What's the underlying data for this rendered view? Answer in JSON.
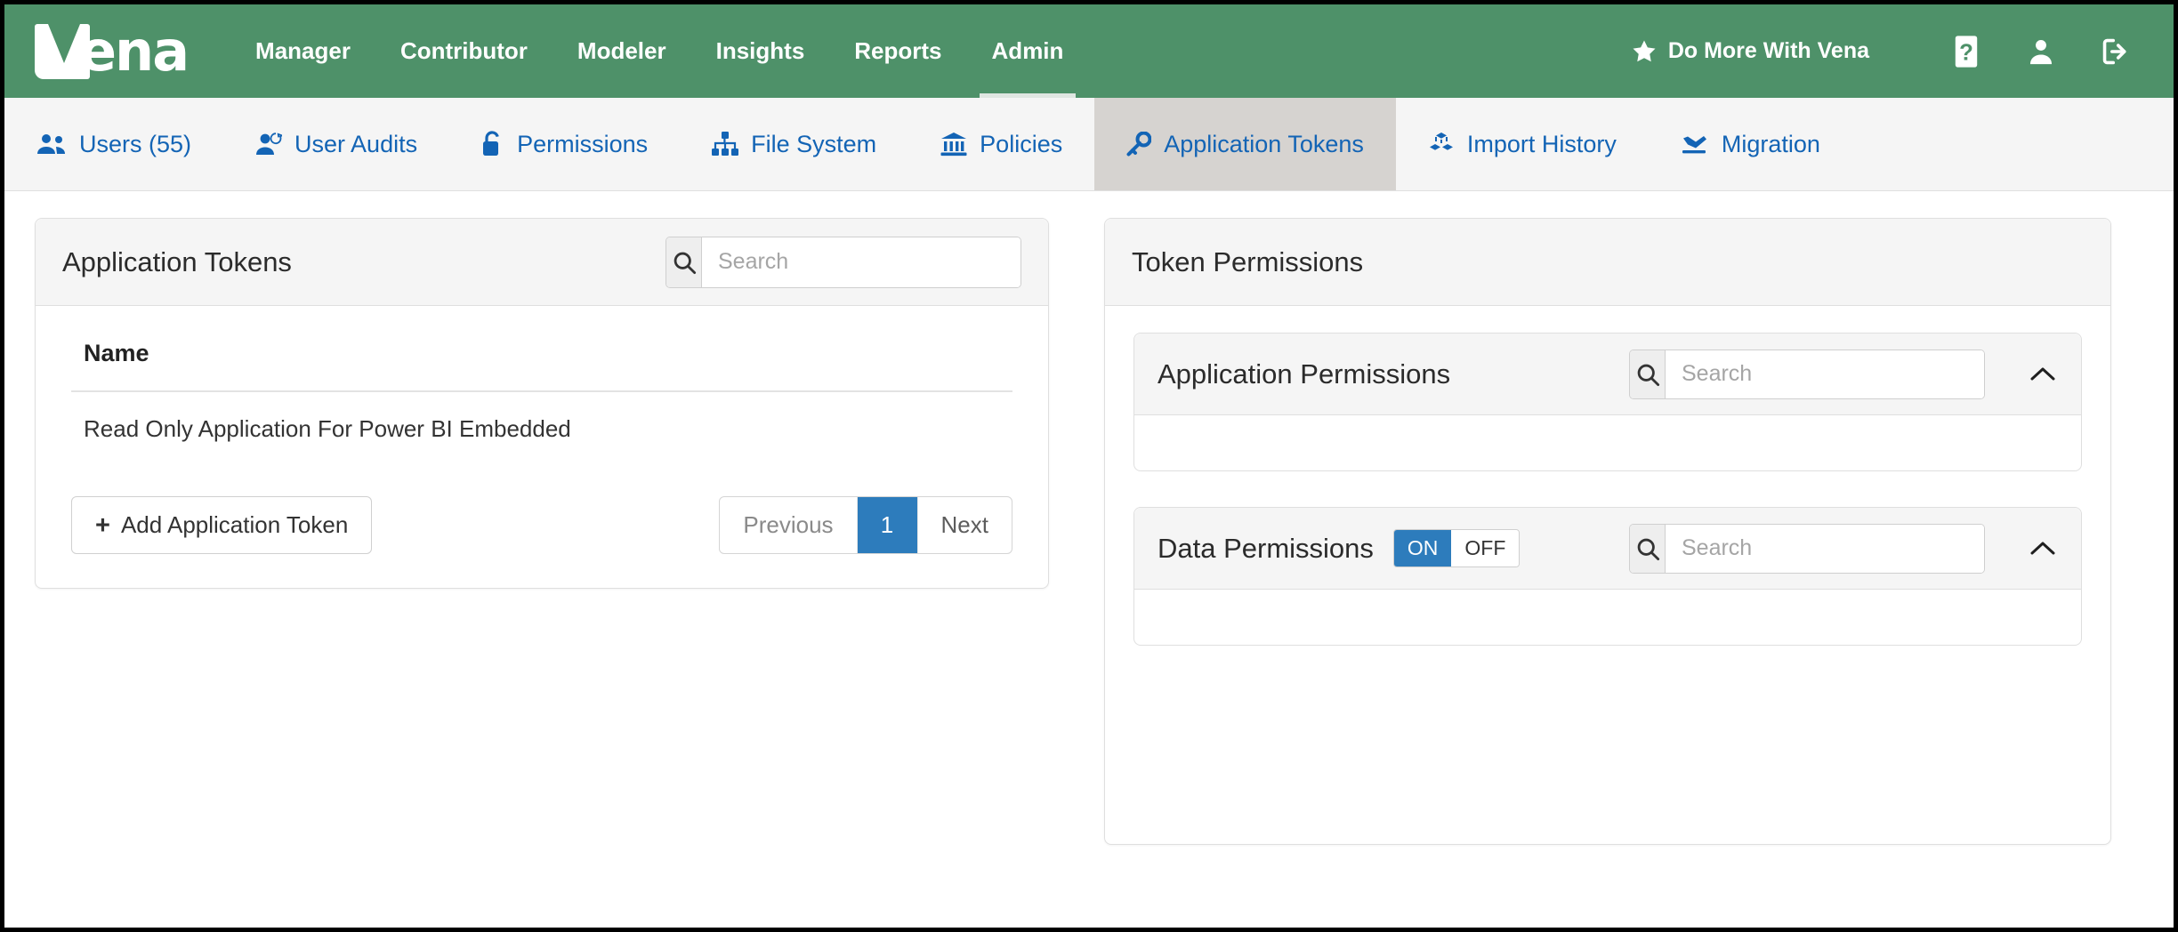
{
  "brand": {
    "logo_text": "ena",
    "green": "#4e9169",
    "blue": "#1364b5",
    "accent_blue": "#2d7cbc"
  },
  "topnav": {
    "items": [
      {
        "label": "Manager",
        "active": false
      },
      {
        "label": "Contributor",
        "active": false
      },
      {
        "label": "Modeler",
        "active": false
      },
      {
        "label": "Insights",
        "active": false
      },
      {
        "label": "Reports",
        "active": false
      },
      {
        "label": "Admin",
        "active": true
      }
    ],
    "do_more_label": "Do More With Vena",
    "icons": [
      "star-icon",
      "help-icon",
      "user-icon",
      "logout-icon"
    ]
  },
  "subnav": {
    "items": [
      {
        "label": "Users (55)",
        "icon": "users-icon",
        "active": false
      },
      {
        "label": "User Audits",
        "icon": "user-audit-icon",
        "active": false
      },
      {
        "label": "Permissions",
        "icon": "unlock-icon",
        "active": false
      },
      {
        "label": "File System",
        "icon": "sitemap-icon",
        "active": false
      },
      {
        "label": "Policies",
        "icon": "bank-icon",
        "active": false
      },
      {
        "label": "Application Tokens",
        "icon": "key-icon",
        "active": true
      },
      {
        "label": "Import History",
        "icon": "cubes-icon",
        "active": false
      },
      {
        "label": "Migration",
        "icon": "plane-icon",
        "active": false
      }
    ]
  },
  "tokens_card": {
    "title": "Application Tokens",
    "search_placeholder": "Search",
    "search_value": "",
    "table": {
      "columns": [
        "Name"
      ],
      "rows": [
        [
          "Read Only Application For Power BI Embedded"
        ]
      ]
    },
    "add_button_label": "Add Application Token",
    "add_button_plus": "+",
    "pagination": {
      "previous_label": "Previous",
      "current_page": "1",
      "next_label": "Next"
    }
  },
  "permissions_card": {
    "title": "Token Permissions",
    "sections": [
      {
        "title": "Application Permissions",
        "search_placeholder": "Search",
        "search_value": "",
        "collapse_icon": "chevron-up-icon",
        "has_toggle": false
      },
      {
        "title": "Data Permissions",
        "search_placeholder": "Search",
        "search_value": "",
        "collapse_icon": "chevron-up-icon",
        "has_toggle": true,
        "toggle": {
          "on_label": "ON",
          "off_label": "OFF",
          "selected": "ON"
        }
      }
    ]
  }
}
